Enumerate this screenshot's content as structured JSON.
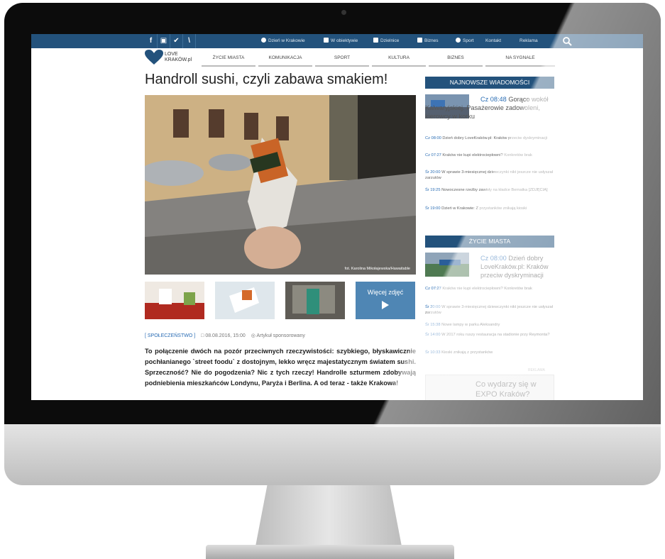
{
  "topbar": {
    "social": [
      "f",
      "▣",
      "✔",
      "\\"
    ],
    "links": [
      {
        "icon": "clock-icon",
        "label": "Dzień w Krakowie"
      },
      {
        "icon": "camera-icon",
        "label": "W obiektywie"
      },
      {
        "icon": "map-icon",
        "label": "Dzielnice"
      },
      {
        "icon": "briefcase-icon",
        "label": "Biznes"
      },
      {
        "icon": "sport-icon",
        "label": "Sport"
      },
      {
        "label": "Kontakt"
      },
      {
        "label": "Reklama"
      }
    ]
  },
  "logo": {
    "line1": "LOVE",
    "line2": "KRAKÓW.pl"
  },
  "nav": [
    "ŻYCIE MIASTA",
    "KOMUNIKACJA",
    "SPORT",
    "KULTURA",
    "BIZNES",
    "NA SYGNALE"
  ],
  "article": {
    "title": "Handroll sushi, czyli zabawa smakiem!",
    "photo_credit": "fot. Karolina Mikołajewska/Hawaitable",
    "more_photos": "Więcej zdjęć",
    "category": "[ SPOŁECZEŃSTWO ]",
    "date": "08.08.2016, 15:00",
    "sponsored": "Artykuł sponsorowany",
    "lead": "To połączenie dwóch na pozór przeciwnych rzeczywistości: szybkiego, błyskawicznie pochłanianego `street foodu` z dostojnym, lekko wręcz majestatycznym światem sushi. Sprzeczność? Nie do pogodzenia? Nic z tych rzeczy! Handrolle szturmem zdobywają podniebienia mieszkańców Londynu, Paryża i Berlina. A od teraz - także Krakowa!"
  },
  "sidebar": {
    "latest": {
      "header": "NAJNOWSZE WIADOMOŚCI",
      "feature_time": "Cz 08:48",
      "feature_text": "Gorąco wokół Kalwaryjskiej. Pasażerowie zadowoleni, kierowcy w korku",
      "items": [
        {
          "time": "Cz 08:00",
          "text": "Dzień dobry LoveKraków.pl: Kraków przeciw dyskryminacji"
        },
        {
          "time": "Cz 07:27",
          "text": "Kraków nie kupi elektrociepłowni? Konkretów brak"
        },
        {
          "time": "Śr 20:00",
          "text": "W sprawie 3-miesięcznej dziewczynki nikt jeszcze nie usłyszał zarzutów"
        },
        {
          "time": "Śr 19:25",
          "text": "Nowoczesne rzeźby zawisły na kładce Bernatka [ZDJĘCIA]"
        },
        {
          "time": "Śr 19:00",
          "text": "Dzień w Krakowie: Z przystanków znikają kioski"
        }
      ]
    },
    "city": {
      "header": "ŻYCIE MIASTA",
      "feature_time": "Cz 08:00",
      "feature_text": "Dzień dobry LoveKraków.pl: Kraków przeciw dyskryminacji",
      "items": [
        {
          "time": "Cz 07:27",
          "text": "Kraków nie kupi elektrociepłowni? Konkretów brak"
        },
        {
          "time": "Śr 20:00",
          "text": "W sprawie 3-miesięcznej dziewczynki nikt jeszcze nie usłyszał zarzutów"
        },
        {
          "time": "Śr 15:38",
          "text": "Nowe lampy w parku Aleksandry"
        },
        {
          "time": "Śr 14:00",
          "text": "W 2017 roku ruszy restauracja na stadionie przy Reymonta?"
        },
        {
          "time": "Śr 10:33",
          "text": "Kioski znikają z przystanków"
        }
      ]
    },
    "ad_label": "REKLAMA",
    "ad_text": "Co wydarzy się w EXPO Kraków?"
  },
  "colors": {
    "brand_blue": "#23527c",
    "link_blue": "#2a6db4"
  }
}
